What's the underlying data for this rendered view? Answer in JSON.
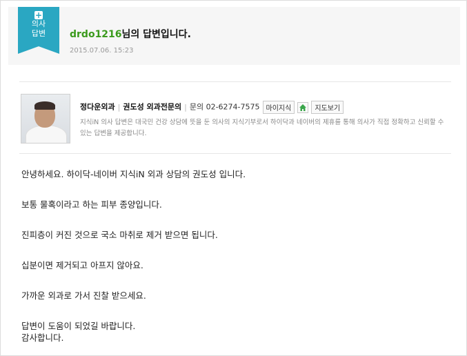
{
  "header": {
    "badge_line1": "의사",
    "badge_line2": "답변",
    "user_id": "drdo1216",
    "title_suffix": "님의 답변입니다.",
    "date": "2015.07.06. 15:23"
  },
  "profile": {
    "clinic": "정다운외과",
    "doctor": "권도성 외과전문의",
    "contact": "문의 02-6274-7575",
    "btn_mypage": "마이지식",
    "btn_map": "지도보기",
    "description": "지식iN 의사 답변은 대국민 건강 상담에 뜻을 둔 의사의 지식기부로서 하이닥과 네이버의 제휴를 통해 의사가 직접 정확하고 신뢰할 수 있는 답변을 제공합니다."
  },
  "answer": [
    "안녕하세요. 하이닥-네이버 지식iN 외과 상담의 권도성 입니다.",
    "보통 물혹이라고 하는 피부 종양입니다.",
    "진피층이 커진 것으로 국소 마취로 제거 받으면 됩니다.",
    "십분이면 제거되고 아프지 않아요.",
    "가까운 외과로 가서 진찰 받으세요.",
    "답변이 도움이 되었길 바랍니다.",
    "감사합니다."
  ],
  "colors": {
    "badge": "#2aa7c2",
    "user_id": "#3a9a1c",
    "home_icon": "#3aa64b"
  }
}
